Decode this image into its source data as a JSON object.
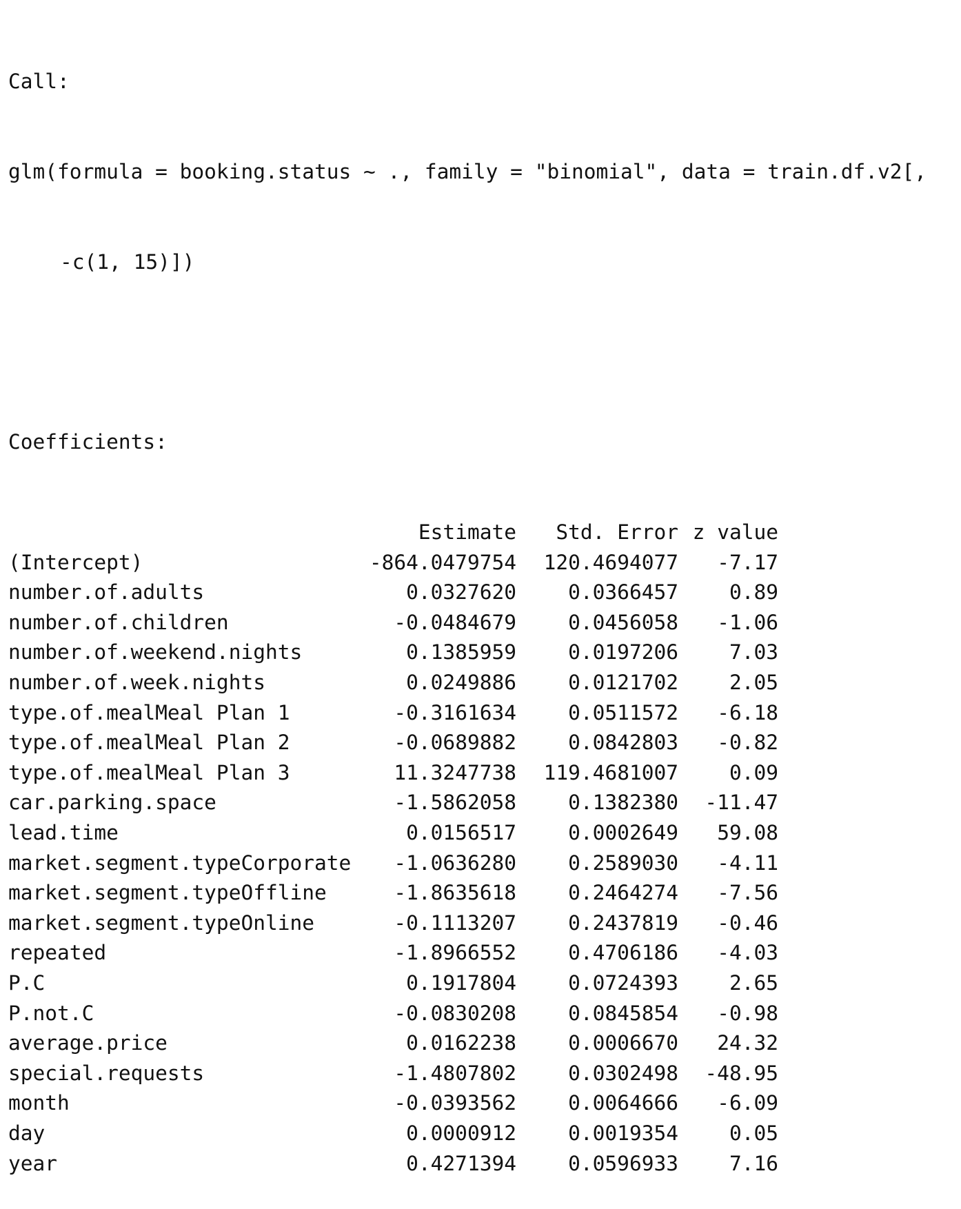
{
  "call": {
    "label": "Call:",
    "formula_line1": "glm(formula = booking.status ~ ., family = \"binomial\", data = train.df.v2[,",
    "formula_line2": "-c(1, 15)])"
  },
  "coefficients": {
    "label": "Coefficients:",
    "headers": [
      "",
      "Estimate",
      "Std. Error",
      "z value"
    ],
    "rows": [
      {
        "term": "(Intercept)",
        "estimate": "-864.0479754",
        "std_error": "120.4694077",
        "z_value": "-7.17"
      },
      {
        "term": "number.of.adults",
        "estimate": "0.0327620",
        "std_error": "0.0366457",
        "z_value": "0.89"
      },
      {
        "term": "number.of.children",
        "estimate": "-0.0484679",
        "std_error": "0.0456058",
        "z_value": "-1.06"
      },
      {
        "term": "number.of.weekend.nights",
        "estimate": "0.1385959",
        "std_error": "0.0197206",
        "z_value": "7.03"
      },
      {
        "term": "number.of.week.nights",
        "estimate": "0.0249886",
        "std_error": "0.0121702",
        "z_value": "2.05"
      },
      {
        "term": "type.of.mealMeal Plan 1",
        "estimate": "-0.3161634",
        "std_error": "0.0511572",
        "z_value": "-6.18"
      },
      {
        "term": "type.of.mealMeal Plan 2",
        "estimate": "-0.0689882",
        "std_error": "0.0842803",
        "z_value": "-0.82"
      },
      {
        "term": "type.of.mealMeal Plan 3",
        "estimate": "11.3247738",
        "std_error": "119.4681007",
        "z_value": "0.09"
      },
      {
        "term": "car.parking.space",
        "estimate": "-1.5862058",
        "std_error": "0.1382380",
        "z_value": "-11.47"
      },
      {
        "term": "lead.time",
        "estimate": "0.0156517",
        "std_error": "0.0002649",
        "z_value": "59.08"
      },
      {
        "term": "market.segment.typeCorporate",
        "estimate": "-1.0636280",
        "std_error": "0.2589030",
        "z_value": "-4.11"
      },
      {
        "term": "market.segment.typeOffline",
        "estimate": "-1.8635618",
        "std_error": "0.2464274",
        "z_value": "-7.56"
      },
      {
        "term": "market.segment.typeOnline",
        "estimate": "-0.1113207",
        "std_error": "0.2437819",
        "z_value": "-0.46"
      },
      {
        "term": "repeated",
        "estimate": "-1.8966552",
        "std_error": "0.4706186",
        "z_value": "-4.03"
      },
      {
        "term": "P.C",
        "estimate": "0.1917804",
        "std_error": "0.0724393",
        "z_value": "2.65"
      },
      {
        "term": "P.not.C",
        "estimate": "-0.0830208",
        "std_error": "0.0845854",
        "z_value": "-0.98"
      },
      {
        "term": "average.price",
        "estimate": "0.0162238",
        "std_error": "0.0006670",
        "z_value": "24.32"
      },
      {
        "term": "special.requests",
        "estimate": "-1.4807802",
        "std_error": "0.0302498",
        "z_value": "-48.95"
      },
      {
        "term": "month",
        "estimate": "-0.0393562",
        "std_error": "0.0064666",
        "z_value": "-6.09"
      },
      {
        "term": "day",
        "estimate": "0.0000912",
        "std_error": "0.0019354",
        "z_value": "0.05"
      },
      {
        "term": "year",
        "estimate": "0.4271394",
        "std_error": "0.0596933",
        "z_value": "7.16"
      }
    ]
  }
}
